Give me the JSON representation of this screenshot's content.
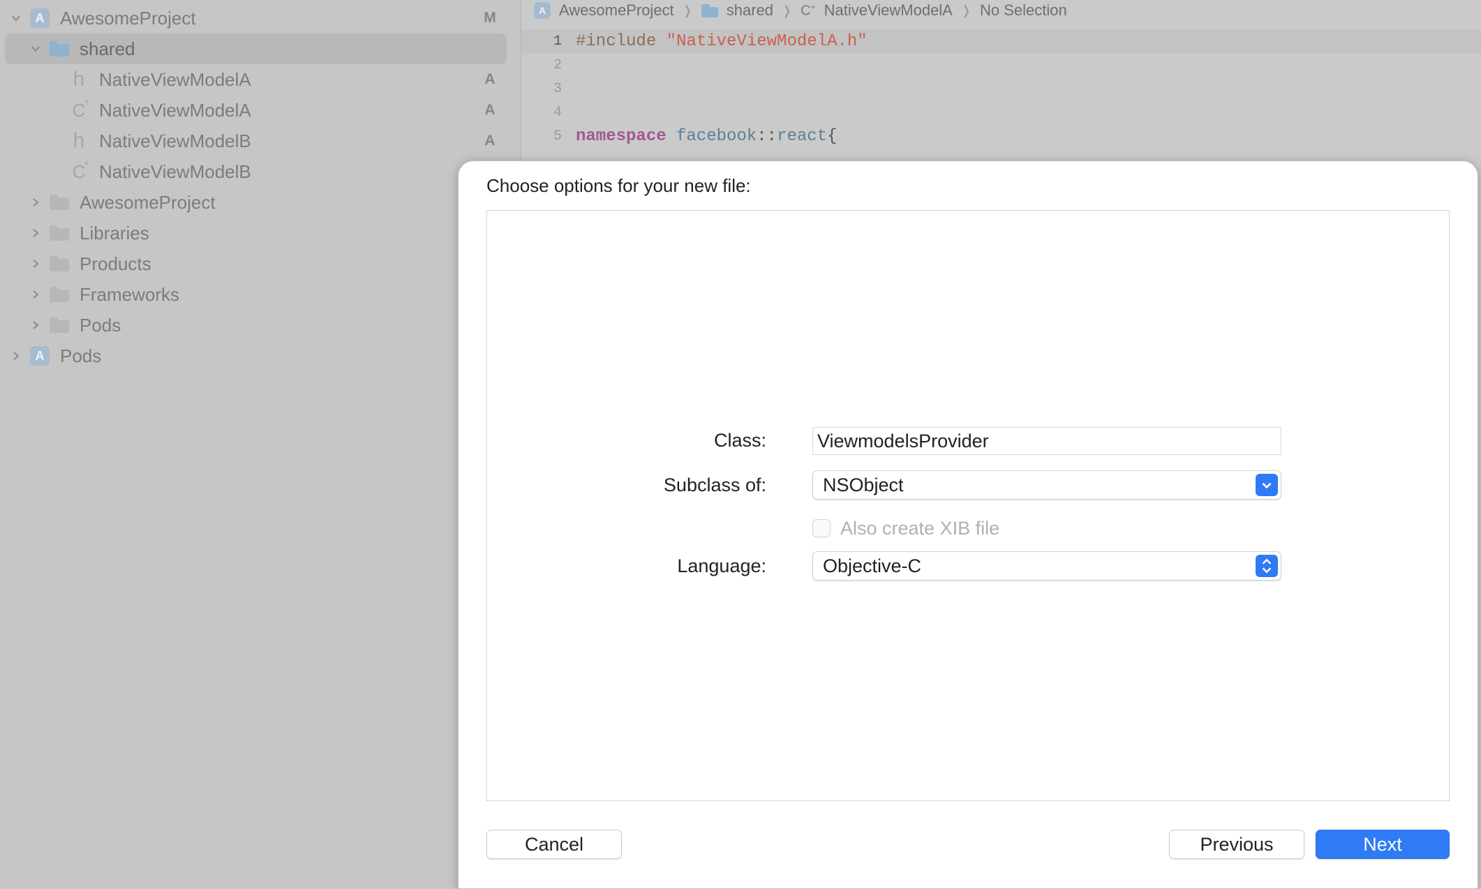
{
  "sidebar": {
    "items": [
      {
        "label": "AwesomeProject",
        "badge": "M"
      },
      {
        "label": "shared",
        "badge": ""
      },
      {
        "label": "NativeViewModelA",
        "badge": "A",
        "type_glyph": "h"
      },
      {
        "label": "NativeViewModelA",
        "badge": "A",
        "type_glyph": "C"
      },
      {
        "label": "NativeViewModelB",
        "badge": "A",
        "type_glyph": "h"
      },
      {
        "label": "NativeViewModelB",
        "badge": "",
        "type_glyph": "C"
      },
      {
        "label": "AwesomeProject",
        "badge": ""
      },
      {
        "label": "Libraries",
        "badge": ""
      },
      {
        "label": "Products",
        "badge": ""
      },
      {
        "label": "Frameworks",
        "badge": ""
      },
      {
        "label": "Pods",
        "badge": ""
      },
      {
        "label": "Pods",
        "badge": ""
      }
    ]
  },
  "jumpbar": {
    "project": "AwesomeProject",
    "folder": "shared",
    "file": "NativeViewModelA",
    "selection": "No Selection"
  },
  "editor": {
    "lines": [
      {
        "number": "1",
        "directive": "#include ",
        "string": "\"NativeViewModelA.h\""
      },
      {
        "number": "2"
      },
      {
        "number": "3"
      },
      {
        "number": "4"
      },
      {
        "number": "5",
        "keyword": "namespace",
        "ns1": "facebook",
        "sep": "::",
        "ns2": "react",
        "brace": "{"
      }
    ]
  },
  "dialog": {
    "title": "Choose options for your new file:",
    "class_label": "Class:",
    "class_value": "ViewmodelsProvider",
    "subclass_label": "Subclass of:",
    "subclass_value": "NSObject",
    "xib_label": "Also create XIB file",
    "language_label": "Language:",
    "language_value": "Objective-C",
    "cancel_label": "Cancel",
    "previous_label": "Previous",
    "next_label": "Next"
  },
  "colors": {
    "accent": "#2f7bf5",
    "string": "#c9614f",
    "keyword": "#a4588f"
  }
}
